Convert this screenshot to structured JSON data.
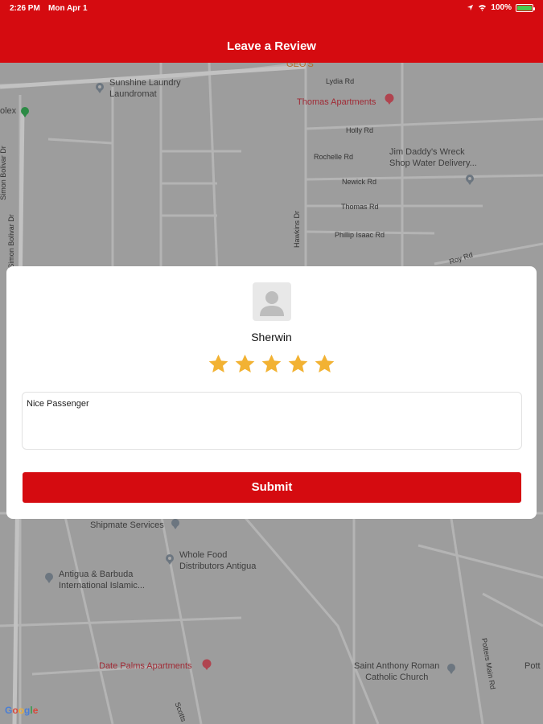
{
  "status_bar": {
    "time": "2:26 PM",
    "date": "Mon Apr 1",
    "battery": "100%",
    "battery_level": 1.0,
    "icons": [
      "location-arrow-icon",
      "wifi-icon",
      "battery-charging-icon"
    ]
  },
  "header": {
    "title": "Leave a Review",
    "color": "#d50b10"
  },
  "map": {
    "labels": {
      "sunshine": "Sunshine Laundry\nLaundromat",
      "geos": "GEO'S",
      "lydia": "Lydia Rd",
      "thomas_apts": "Thomas Apartments",
      "holly": "Holly Rd",
      "rochelle": "Rochelle Rd",
      "jim_daddy": "Jim Daddy's Wreck\nShop Water Delivery...",
      "newick": "Newick Rd",
      "thomas_rd": "Thomas Rd",
      "phillip": "Phillip Isaac Rd",
      "roy": "Roy Rd",
      "hawkins": "Hawkins Dr",
      "simon1": "Simon Bolivar Dr",
      "simon2": "Simon Bolivar Dr",
      "olex": "olex",
      "shipmate": "Shipmate Services",
      "whole_food": "Whole Food\nDistributors Antigua",
      "antigua": "Antigua & Barbuda\nInternational Islamic...",
      "date_palms": "Date Palms Apartments",
      "saint_anthony": "Saint Anthony Roman\nCatholic Church",
      "potters": "Potters Main Rd",
      "potts": "Pott",
      "scotts": "Scotts"
    },
    "google_logo": "Google"
  },
  "review": {
    "name": "Sherwin",
    "rating": 5,
    "max_rating": 5,
    "comment": "Nice Passenger",
    "submit_label": "Submit",
    "star_color": "#f2b233"
  }
}
